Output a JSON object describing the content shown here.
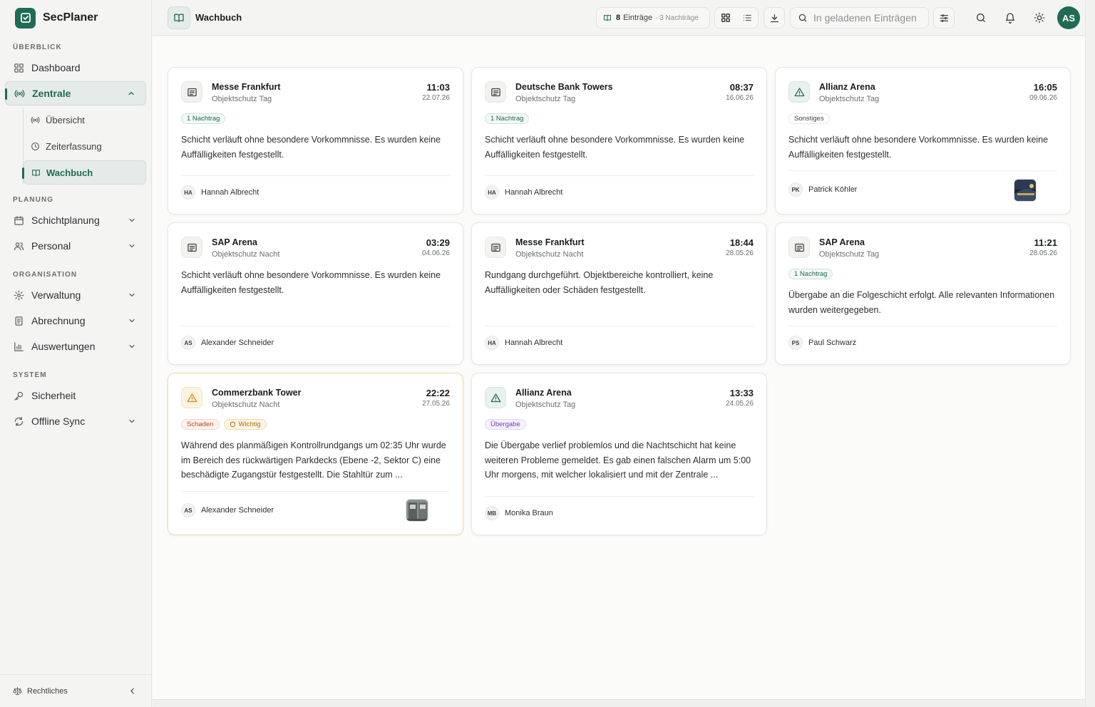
{
  "app": {
    "name": "SecPlaner"
  },
  "sidebar": {
    "sections": {
      "overview": "ÜBERBLICK",
      "planning": "PLANUNG",
      "organisation": "ORGANISATION",
      "system": "SYSTEM"
    },
    "items": {
      "dashboard": "Dashboard",
      "zentrale": "Zentrale",
      "uebersicht": "Übersicht",
      "zeiterfassung": "Zeiterfassung",
      "wachbuch": "Wachbuch",
      "schichtplanung": "Schichtplanung",
      "personal": "Personal",
      "verwaltung": "Verwaltung",
      "abrechnung": "Abrechnung",
      "auswertungen": "Auswertungen",
      "sicherheit": "Sicherheit",
      "offline_sync": "Offline Sync"
    },
    "footer": "Rechtliches"
  },
  "topbar": {
    "title": "Wachbuch",
    "count": "8",
    "count_label": "Einträge",
    "count_sub": "· 3 Nachträge",
    "search_placeholder": "In geladenen Einträgen",
    "user_initials": "AS"
  },
  "cards": [
    {
      "title": "Messe Frankfurt",
      "subtitle": "Objektschutz Tag",
      "time": "11:03",
      "date": "22.07.26",
      "tags": [
        "1 Nachtrag"
      ],
      "text": "Schicht verläuft ohne besondere Vorkommnisse. Es wurden keine Auffälligkeiten festgestellt.",
      "initials": "HA",
      "author": "Hannah Albrecht"
    },
    {
      "title": "Deutsche Bank Towers",
      "subtitle": "Objektschutz Tag",
      "time": "08:37",
      "date": "16.06.26",
      "tags": [
        "1 Nachtrag"
      ],
      "text": "Schicht verläuft ohne besondere Vorkommnisse. Es wurden keine Auffälligkeiten festgestellt.",
      "initials": "HA",
      "author": "Hannah Albrecht"
    },
    {
      "title": "Allianz Arena",
      "subtitle": "Objektschutz Tag",
      "time": "16:05",
      "date": "09.06.26",
      "tags": [
        "Sonstiges"
      ],
      "text": "Schicht verläuft ohne besondere Vorkommnisse. Es wurden keine Auffälligkeiten festgestellt.",
      "initials": "PK",
      "author": "Patrick Köhler"
    },
    {
      "title": "SAP Arena",
      "subtitle": "Objektschutz Nacht",
      "time": "03:29",
      "date": "04.06.26",
      "tags": [],
      "text": "Schicht verläuft ohne besondere Vorkommnisse. Es wurden keine Auffälligkeiten festgestellt.",
      "initials": "AS",
      "author": "Alexander Schneider"
    },
    {
      "title": "Messe Frankfurt",
      "subtitle": "Objektschutz Nacht",
      "time": "18:44",
      "date": "28.05.26",
      "tags": [],
      "text": "Rundgang durchgeführt. Objektbereiche kontrolliert, keine Auffälligkeiten oder Schäden festgestellt.",
      "initials": "HA",
      "author": "Hannah Albrecht"
    },
    {
      "title": "SAP Arena",
      "subtitle": "Objektschutz Tag",
      "time": "11:21",
      "date": "28.05.26",
      "tags": [
        "1 Nachtrag"
      ],
      "text": "Übergabe an die Folgeschicht erfolgt. Alle relevanten Informationen wurden weitergegeben.",
      "initials": "PS",
      "author": "Paul Schwarz"
    },
    {
      "title": "Commerzbank Tower",
      "subtitle": "Objektschutz Nacht",
      "time": "22:22",
      "date": "27.05.26",
      "tags": [
        "Schaden",
        "Wichtig"
      ],
      "text": "Während des planmäßigen Kontrollrundgangs um 02:35 Uhr wurde im Bereich des rückwärtigen Parkdecks (Ebene -2, Sektor C) eine beschädigte Zugangstür festgestellt. Die Stahltür zum ...",
      "initials": "AS",
      "author": "Alexander Schneider"
    },
    {
      "title": "Allianz Arena",
      "subtitle": "Objektschutz Tag",
      "time": "13:33",
      "date": "24.05.26",
      "tags": [
        "Übergabe"
      ],
      "text": "Die Übergabe verlief problemlos und die Nachtschicht hat keine weiteren Probleme gemeldet. Es gab einen falschen Alarm um 5:00 Uhr morgens, mit welcher lokalisiert und mit der Zentrale ...",
      "initials": "MB",
      "author": "Monika Braun"
    }
  ],
  "colors": {
    "brand": "#1f6b55",
    "warning": "#d98a14"
  }
}
